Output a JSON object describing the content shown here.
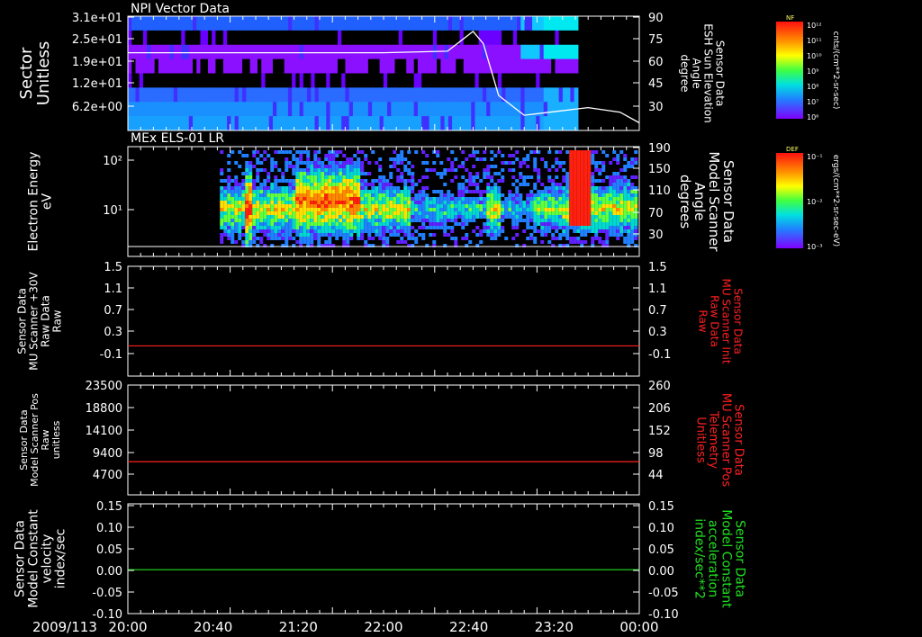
{
  "date_label": "2009/113",
  "time_ticks": [
    "20:00",
    "20:40",
    "21:20",
    "22:00",
    "22:40",
    "23:20",
    "00:00"
  ],
  "chart_data": [
    {
      "type": "heatmap",
      "title": "NPI Vector Data",
      "ylabel_left": [
        "Sector",
        "Unitless"
      ],
      "yticks_left": [
        "3.1e+01",
        "2.5e+01",
        "1.9e+01",
        "1.2e+01",
        "6.2e+00"
      ],
      "ylabel_right": [
        "Sensor Data",
        "ESH Sun Elevation",
        "Angle",
        "degree"
      ],
      "yticks_right": [
        "90",
        "75",
        "60",
        "45",
        "30"
      ],
      "ylim_right": [
        15,
        90
      ],
      "overlay_line": {
        "x_hours": [
          20.0,
          21.0,
          22.0,
          22.5,
          22.7,
          22.78,
          22.9,
          23.1,
          23.3,
          23.6,
          23.85,
          24.0
        ],
        "y_degree": [
          66,
          66,
          66,
          67,
          80,
          72,
          38,
          25,
          27,
          30,
          27,
          20
        ]
      },
      "colorbar": {
        "label": "cnts/(cm**2-sr-sec)",
        "title": "NF",
        "ticks": [
          "10¹²",
          "10¹¹",
          "10¹⁰",
          "10⁹",
          "10⁸",
          "10⁷",
          "10⁶"
        ]
      }
    },
    {
      "type": "heatmap",
      "title": "MEx ELS-01 LR",
      "ylabel_left": [
        "Electron Energy",
        "eV"
      ],
      "yticks_left": [
        "10²",
        "10¹"
      ],
      "ylabel_right": [
        "Sensor Data",
        "Model Scanner",
        "Angle",
        "degrees"
      ],
      "yticks_right": [
        "190",
        "150",
        "110",
        "70",
        "30"
      ],
      "colorbar": {
        "label": "ergs/(cm**2-sr-sec-eV)",
        "title": "DEF",
        "ticks": [
          "10⁻¹",
          "10⁻²",
          "10⁻³"
        ]
      }
    },
    {
      "type": "line",
      "ylabel_left": [
        "Sensor Data",
        "MU Scanner +30V",
        "Raw Data",
        "Raw"
      ],
      "yticks_left": [
        "1.5",
        "1.1",
        "0.7",
        "0.3",
        "-0.1"
      ],
      "ylabel_right": [
        "Sensor Data",
        "MU Scanner Init",
        "Raw Data",
        "Raw"
      ],
      "yticks_right": [
        "1.5",
        "1.1",
        "0.7",
        "0.3",
        "-0.1"
      ],
      "ylim": [
        -0.5,
        1.5
      ],
      "series": [
        {
          "color": "#ff2020",
          "y": 0.05
        }
      ]
    },
    {
      "type": "line",
      "ylabel_left": [
        "Sensor Data",
        "Model Scanner Pos",
        "Raw",
        "unitless"
      ],
      "yticks_left": [
        "23500",
        "18800",
        "14100",
        "9400",
        "4700"
      ],
      "ylabel_right": [
        "Sensor Data",
        "MU Scanner Pos",
        "Telemetry",
        "Unitless"
      ],
      "yticks_right": [
        "260",
        "206",
        "152",
        "98",
        "44"
      ],
      "ylim": [
        0,
        23500
      ],
      "series": [
        {
          "color": "#ff2020",
          "y": 7100
        }
      ]
    },
    {
      "type": "line",
      "ylabel_left": [
        "Sensor Data",
        "Model Constant",
        "velocity",
        "index/sec"
      ],
      "yticks_left": [
        "0.15",
        "0.10",
        "0.05",
        "0.00",
        "-0.05",
        "-0.10"
      ],
      "ylabel_right": [
        "Sensor Data",
        "Model Constant",
        "acceleration",
        "index/sec**2"
      ],
      "yticks_right": [
        "0.15",
        "0.10",
        "0.05",
        "0.00",
        "-0.05",
        "-0.10"
      ],
      "ylim": [
        -0.1,
        0.15
      ],
      "series": [
        {
          "color": "#20e020",
          "y": 0.0
        }
      ]
    }
  ]
}
